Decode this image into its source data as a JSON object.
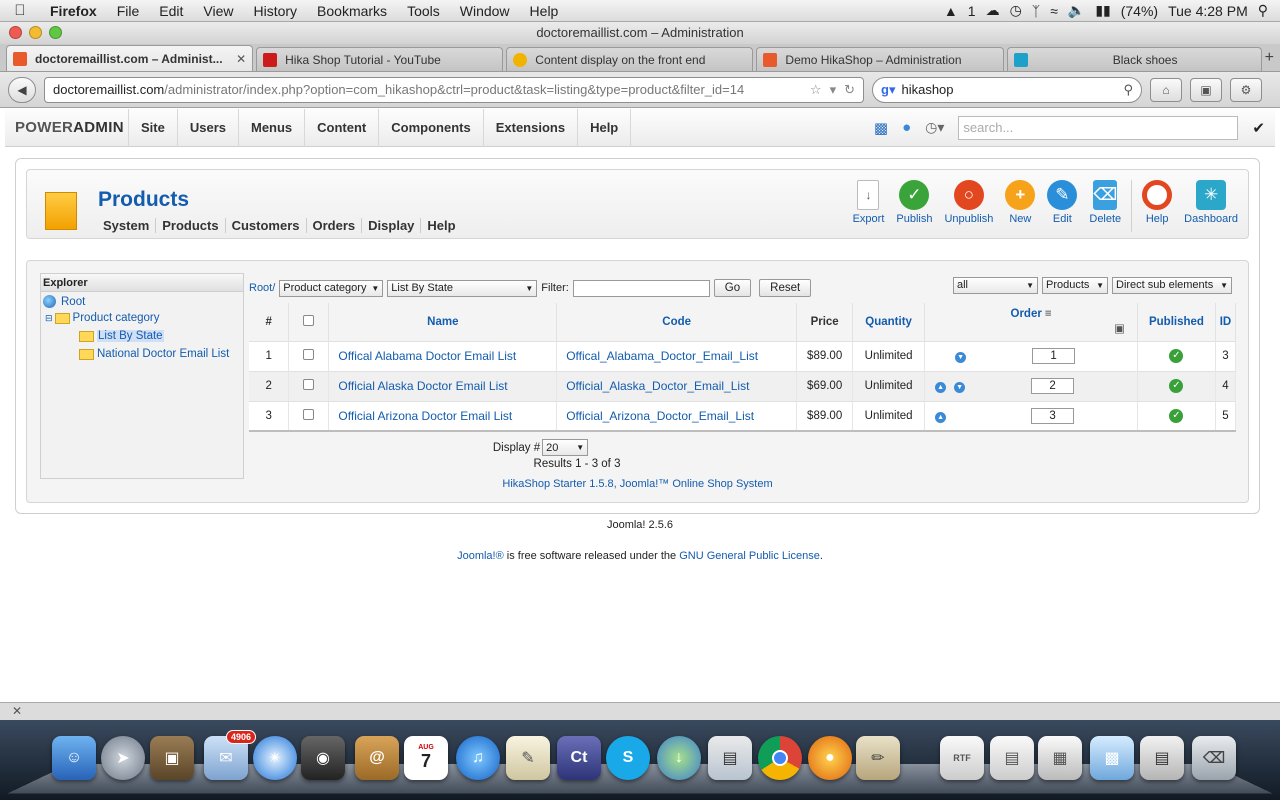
{
  "menubar": {
    "app": "Firefox",
    "items": [
      "File",
      "Edit",
      "View",
      "History",
      "Bookmarks",
      "Tools",
      "Window",
      "Help"
    ],
    "status_num": "1",
    "battery": "(74%)",
    "clock": "Tue 4:28 PM"
  },
  "window": {
    "title": "doctoremaillist.com – Administration"
  },
  "tabs": [
    {
      "label": "doctoremaillist.com – Administ...",
      "icon": "joomla-icon",
      "color": "#e8592c"
    },
    {
      "label": "Hika Shop Tutorial - YouTube",
      "icon": "youtube-icon",
      "color": "#cc1b1b"
    },
    {
      "label": "Content display on the front end",
      "icon": "hikashop-icon",
      "color": "#f0b400"
    },
    {
      "label": "Demo HikaShop – Administration",
      "icon": "joomla-icon",
      "color": "#e8592c"
    },
    {
      "label": "Black shoes",
      "icon": "hikashop-asterisk-icon",
      "color": "#1da1c8"
    }
  ],
  "nav": {
    "url_host": "doctoremaillist.com",
    "url_path": "/administrator/index.php?option=com_hikashop&ctrl=product&task=listing&type=product&filter_id=14",
    "search_value": "hikashop"
  },
  "admin": {
    "brand_light": "POWER",
    "brand_bold": "ADMIN",
    "menu": [
      "Site",
      "Users",
      "Menus",
      "Content",
      "Components",
      "Extensions",
      "Help"
    ],
    "search_placeholder": "search..."
  },
  "page": {
    "title": "Products",
    "submenu": [
      "System",
      "Products",
      "Customers",
      "Orders",
      "Display",
      "Help"
    ],
    "toolbar": [
      {
        "label": "Export",
        "icon": "export-icon",
        "color": "#ffffff"
      },
      {
        "label": "Publish",
        "icon": "publish-check-icon",
        "color": "#3aa43a"
      },
      {
        "label": "Unpublish",
        "icon": "unpublish-icon",
        "color": "#e2471f"
      },
      {
        "label": "New",
        "icon": "new-plus-icon",
        "color": "#f7a21b"
      },
      {
        "label": "Edit",
        "icon": "edit-pencil-icon",
        "color": "#2a8fd8"
      },
      {
        "label": "Delete",
        "icon": "delete-trash-icon",
        "color": "#3aa0e0"
      },
      {
        "label": "Help",
        "icon": "help-lifebuoy-icon",
        "color": "#e2471f"
      },
      {
        "label": "Dashboard",
        "icon": "dashboard-icon",
        "color": "#2aa7c9"
      }
    ]
  },
  "explorer": {
    "title": "Explorer",
    "nodes": [
      "Root",
      "Product category",
      "List By State",
      "National Doctor Email List"
    ]
  },
  "filters": {
    "root_link": "Root/",
    "category_select": "Product category",
    "subcategory_select": "List By State",
    "filter_label": "Filter:",
    "filter_value": "",
    "go_label": "Go",
    "reset_label": "Reset",
    "status_select": "all",
    "type_select": "Products",
    "scope_select": "Direct sub elements"
  },
  "table": {
    "headers": {
      "num": "#",
      "name": "Name",
      "code": "Code",
      "price": "Price",
      "quantity": "Quantity",
      "order": "Order",
      "published": "Published",
      "id": "ID"
    },
    "rows": [
      {
        "num": "1",
        "name": "Offical Alabama Doctor Email List",
        "code": "Offical_Alabama_Doctor_Email_List",
        "price": "$89.00",
        "quantity": "Unlimited",
        "order": "1",
        "id": "3"
      },
      {
        "num": "2",
        "name": "Official Alaska Doctor Email List",
        "code": "Official_Alaska_Doctor_Email_List",
        "price": "$69.00",
        "quantity": "Unlimited",
        "order": "2",
        "id": "4"
      },
      {
        "num": "3",
        "name": "Official Arizona Doctor Email List",
        "code": "Official_Arizona_Doctor_Email_List",
        "price": "$89.00",
        "quantity": "Unlimited",
        "order": "3",
        "id": "5"
      }
    ]
  },
  "pagination": {
    "display_label": "Display #",
    "display_value": "20",
    "results": "Results 1 - 3 of 3"
  },
  "footer": {
    "powered": "HikaShop Starter 1.5.8, Joomla!™ Online Shop System",
    "version": "Joomla! 2.5.6",
    "joomla_link": "Joomla!®",
    "license_text": " is free software released under the ",
    "license_link": "GNU General Public License",
    "license_end": "."
  },
  "dock": {
    "mail_badge": "4906",
    "calendar_month": "AUG",
    "calendar_day": "7"
  }
}
